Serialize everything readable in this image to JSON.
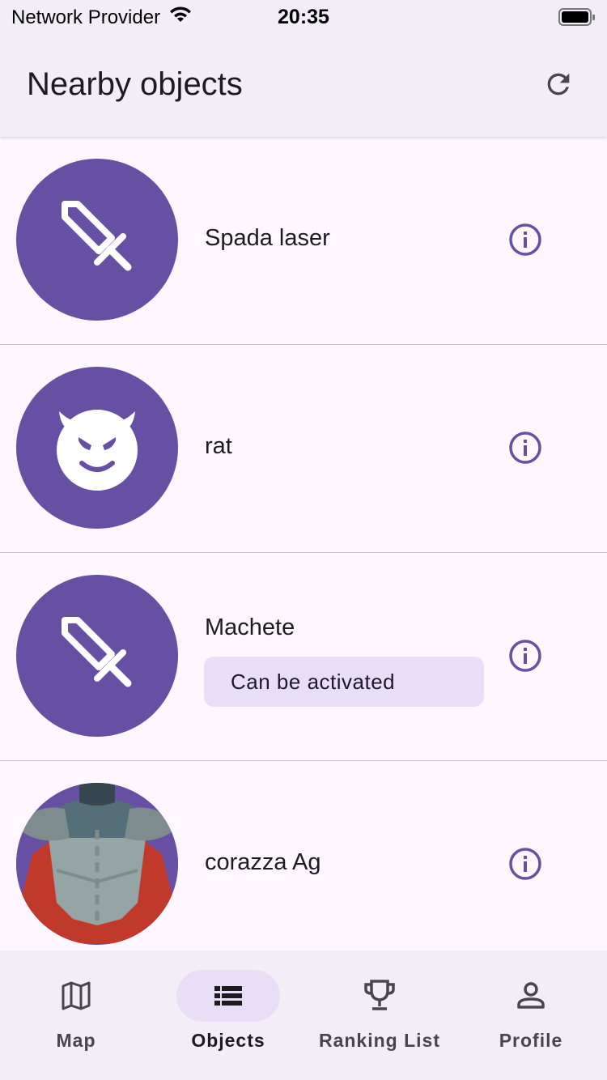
{
  "status_bar": {
    "provider": "Network Provider",
    "time": "20:35",
    "icons": [
      "wifi-icon",
      "battery-icon"
    ]
  },
  "app_bar": {
    "title": "Nearby objects",
    "action_icon": "refresh-icon"
  },
  "objects": [
    {
      "name": "Spada laser",
      "icon": "sword-icon",
      "chip": ""
    },
    {
      "name": "rat",
      "icon": "devil-face-icon",
      "chip": ""
    },
    {
      "name": "Machete",
      "icon": "sword-icon",
      "chip": "Can be activated"
    },
    {
      "name": "corazza Ag",
      "icon": "armor-image",
      "chip": ""
    }
  ],
  "row_action_icon": "info-icon",
  "bottom_nav": {
    "items": [
      {
        "label": "Map",
        "icon": "map-icon",
        "active": false
      },
      {
        "label": "Objects",
        "icon": "list-icon",
        "active": true
      },
      {
        "label": "Ranking List",
        "icon": "trophy-icon",
        "active": false
      },
      {
        "label": "Profile",
        "icon": "person-icon",
        "active": false
      }
    ]
  },
  "colors": {
    "primary": "#6750a4",
    "surface": "#fef7ff",
    "surface_container": "#f3edf7",
    "secondary_container": "#e8def8",
    "armor_red": "#c0392b",
    "armor_steel": "#95a5a6"
  }
}
